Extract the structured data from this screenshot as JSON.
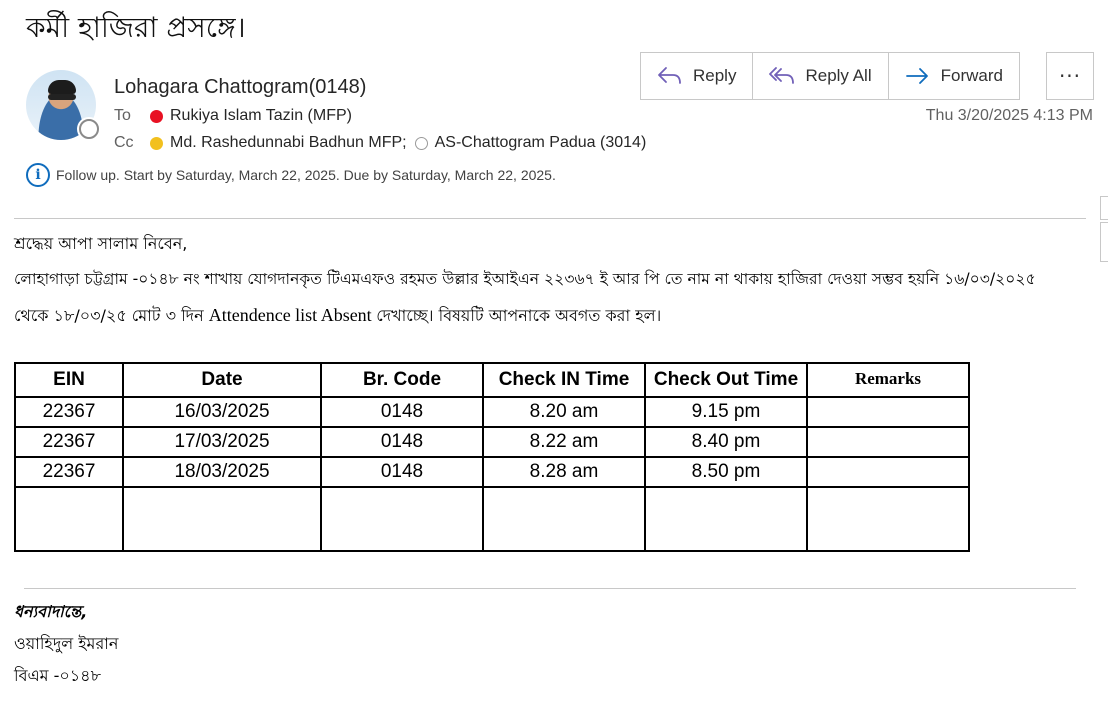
{
  "subject": "কর্মী হাজিরা প্রসঙ্গে।",
  "sender": {
    "name": "Lohagara Chattogram(0148)"
  },
  "to": {
    "label": "To",
    "recipients": [
      {
        "name": "Rukiya Islam Tazin (MFP)",
        "status_color": "#e81123"
      }
    ]
  },
  "cc": {
    "label": "Cc",
    "recipients": [
      {
        "name": "Md. Rashedunnabi Badhun MFP;",
        "status_color": "#f2c01e"
      },
      {
        "name": "AS-Chattogram Padua  (3014)",
        "status_color": "none"
      }
    ]
  },
  "date": "Thu 3/20/2025 4:13 PM",
  "actions": {
    "reply": "Reply",
    "reply_all": "Reply All",
    "forward": "Forward",
    "more": "···"
  },
  "followup": {
    "icon": "info-icon",
    "text": "Follow up.  Start by Saturday, March 22, 2025.  Due by Saturday, March 22, 2025."
  },
  "body": {
    "greeting": "শ্রদ্ধেয় আপা সালাম নিবেন,",
    "line1": "লোহাগাড়া চট্টগ্রাম -০১৪৮ নং শাখায় যোগদানকৃত টিএমএফও রহমত উল্লার ইআইএন ২২৩৬৭ ই আর পি তে নাম না থাকায় হাজিরা দেওয়া সম্ভব  হয়নি ১৬/০৩/২০২৫",
    "line2_start": "থেকে ১৮/০৩/২৫ মোট ৩ দিন ",
    "line2_latin": "Attendence list Absent ",
    "line2_end": " দেখাচ্ছে। বিষয়টি আপনাকে অবগত করা হল।"
  },
  "table": {
    "headers": [
      "EIN",
      "Date",
      "Br. Code",
      "Check IN Time",
      "Check Out Time",
      "Remarks"
    ],
    "rows": [
      [
        "22367",
        "16/03/2025",
        "0148",
        "8.20 am",
        "9.15 pm",
        ""
      ],
      [
        "22367",
        "17/03/2025",
        "0148",
        "8.22 am",
        "8.40 pm",
        ""
      ],
      [
        "22367",
        "18/03/2025",
        "0148",
        "8.28 am",
        "8.50 pm",
        ""
      ],
      [
        "",
        "",
        "",
        "",
        "",
        ""
      ]
    ]
  },
  "signature": {
    "thanks": "ধন্যবাদান্তে,",
    "name": "ওয়াহিদুল ইমরান",
    "title": "বিএম -০১৪৮"
  }
}
